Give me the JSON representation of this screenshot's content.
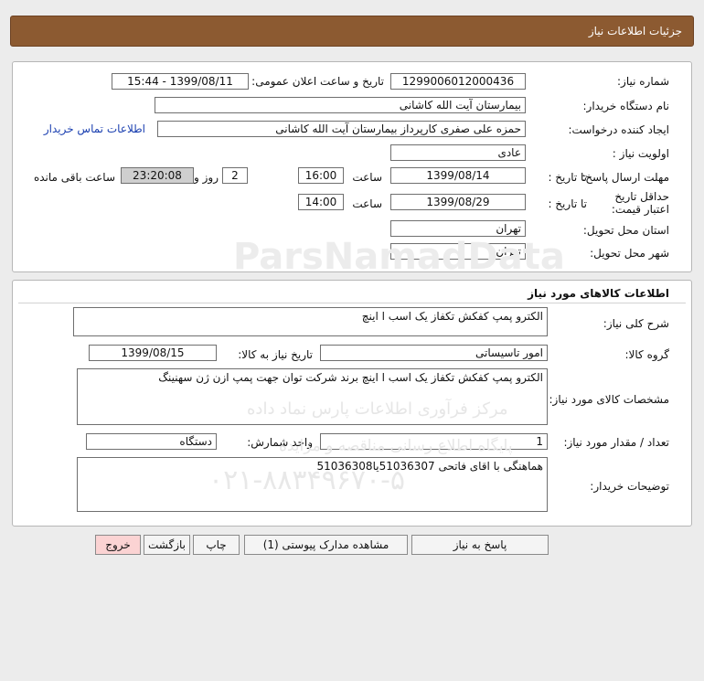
{
  "header": {
    "title": "جزئیات اطلاعات نیاز"
  },
  "info": {
    "need_number_label": "شماره نیاز:",
    "need_number": "1299006012000436",
    "announce_label": "تاریخ و ساعت اعلان عمومی:",
    "announce_value": "1399/08/11 - 15:44",
    "buyer_org_label": "نام دستگاه خریدار:",
    "buyer_org": "بیمارستان آیت الله کاشانی",
    "requester_label": "ایجاد کننده درخواست:",
    "requester": "حمزه علی صفری کارپرداز بیمارستان آیت الله کاشانی",
    "contact_link": "اطلاعات تماس خریدار",
    "priority_label": "اولویت نیاز :",
    "priority": "عادی",
    "deadline_label": "مهلت ارسال پاسخ:",
    "until_date_label": "تا تاریخ :",
    "deadline_date": "1399/08/14",
    "time_label": "ساعت",
    "deadline_time": "16:00",
    "days_value": "2",
    "days_label": "روز و",
    "remaining_time": "23:20:08",
    "remaining_label": "ساعت باقی مانده",
    "price_validity_label": "حداقل تاریخ اعتبار قیمت:",
    "validity_until_label": "تا تاریخ :",
    "validity_date": "1399/08/29",
    "validity_time_label": "ساعت",
    "validity_time": "14:00",
    "province_label": "استان محل تحویل:",
    "province": "تهران",
    "city_label": "شهر محل تحویل:",
    "city": "تهران"
  },
  "goods": {
    "section_title": "اطلاعات کالاهای مورد نیاز",
    "general_desc_label": "شرح کلی نیاز:",
    "general_desc": "الکترو پمپ کفکش تکفاز یک اسب ا اینچ",
    "group_label": "گروه کالا:",
    "group": "امور تاسیساتی",
    "need_date_label": "تاریخ نیاز به کالا:",
    "need_date": "1399/08/15",
    "spec_label": "مشخصات کالای مورد نیاز:",
    "spec": "الکترو پمپ کفکش تکفاز یک اسب ا اینچ برند شرکت توان جهت پمپ ازن ژن سهنینگ",
    "qty_label": "تعداد / مقدار مورد نیاز:",
    "qty": "1",
    "unit_label": "واحد شمارش:",
    "unit": "دستگاه",
    "buyer_notes_label": "توضیحات خریدار:",
    "buyer_notes": "هماهنگی با اقای فاتحی 51036307یا51036308"
  },
  "buttons": {
    "reply": "پاسخ به نیاز",
    "attachments": "مشاهده مدارک پیوستی (1)",
    "print": "چاپ",
    "back": "بازگشت",
    "exit": "خروج"
  },
  "watermark": {
    "brand": "ParsNamadData",
    "line1": "مرکز فرآوری اطلاعات پارس نماد داده",
    "line2": "پایگاه اطلاع رسانی مناقصه و مزایده",
    "phone": "۰۲۱-۸۸۳۴۹۶۷۰-۵"
  },
  "colors": {
    "header_bg": "#8c5a31",
    "link": "#1a3fb0",
    "exit_button_bg": "#fbd3d3"
  }
}
